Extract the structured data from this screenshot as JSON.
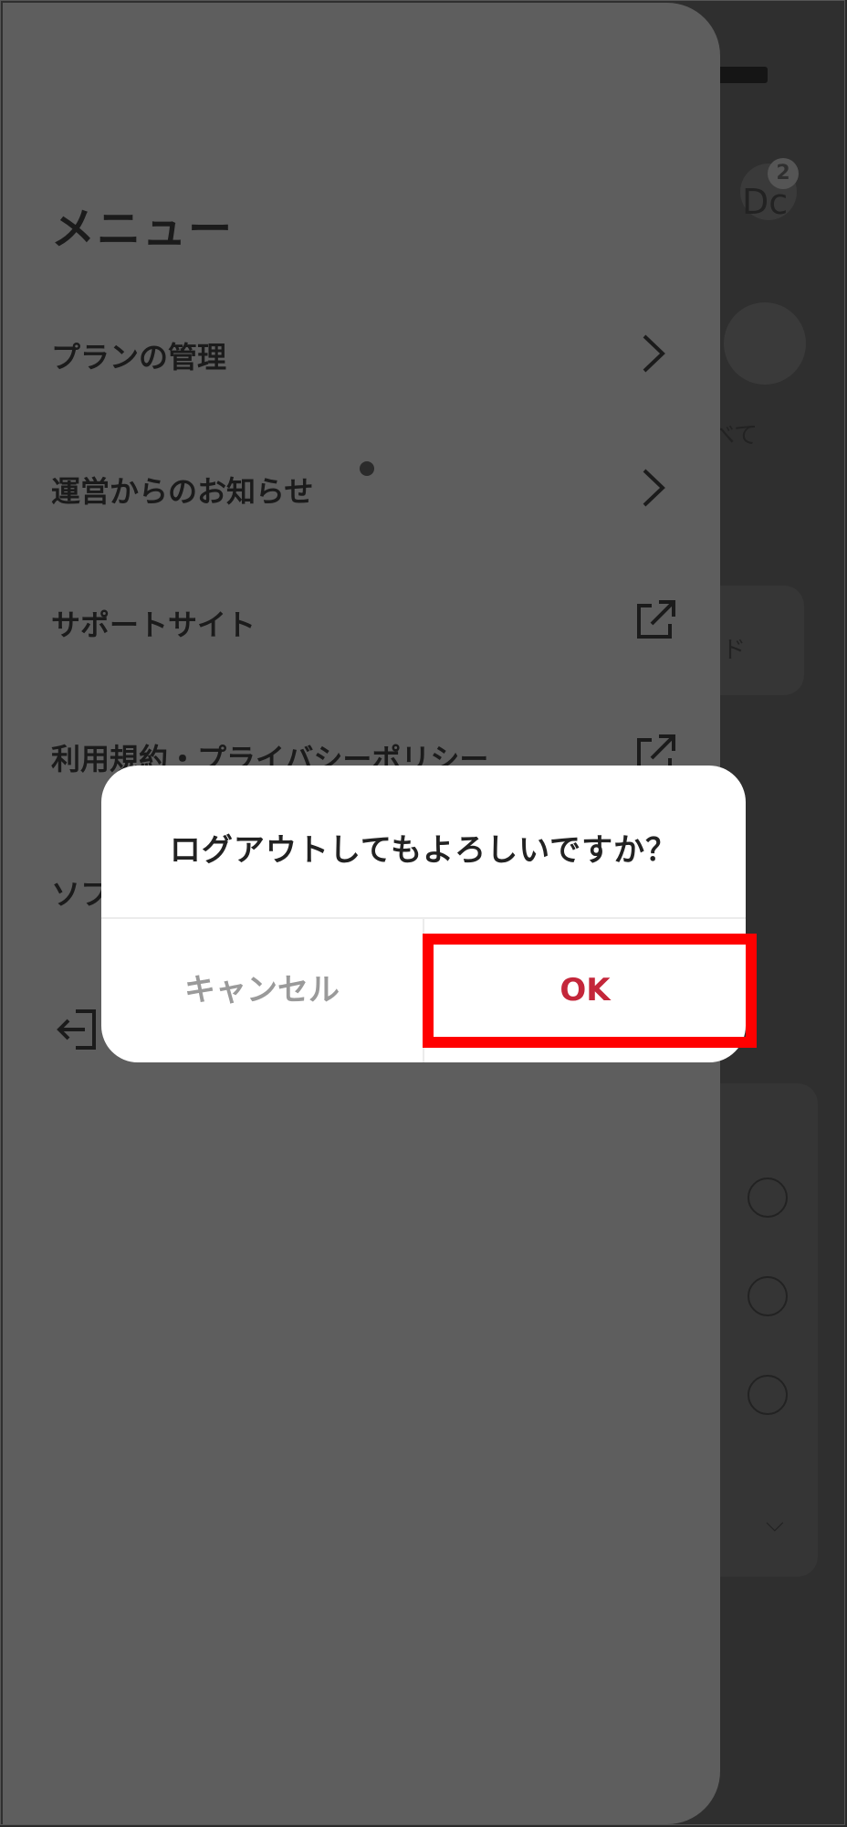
{
  "background": {
    "avatar_badge": "2",
    "avatar_text": "Dc",
    "caption_1": "べて",
    "caption_2": "ド"
  },
  "menu": {
    "title": "メニュー",
    "items": [
      {
        "label": "プランの管理",
        "icon": "chevron-right-icon"
      },
      {
        "label": "運営からのお知らせ",
        "icon": "chevron-right-icon",
        "has_dot": true
      },
      {
        "label": "サポートサイト",
        "icon": "external-link-icon"
      },
      {
        "label": "利用規約・プライバシーポリシー",
        "icon": "external-link-icon"
      },
      {
        "label": "ソフ",
        "icon": ""
      },
      {
        "label": "",
        "icon": "logout-icon"
      }
    ]
  },
  "dialog": {
    "message": "ログアウトしてもよろしいですか？",
    "cancel_label": "キャンセル",
    "ok_label": "OK"
  },
  "colors": {
    "drawer": "#5e5e5e",
    "ok_text": "#c4263a",
    "highlight": "#ff0000"
  }
}
